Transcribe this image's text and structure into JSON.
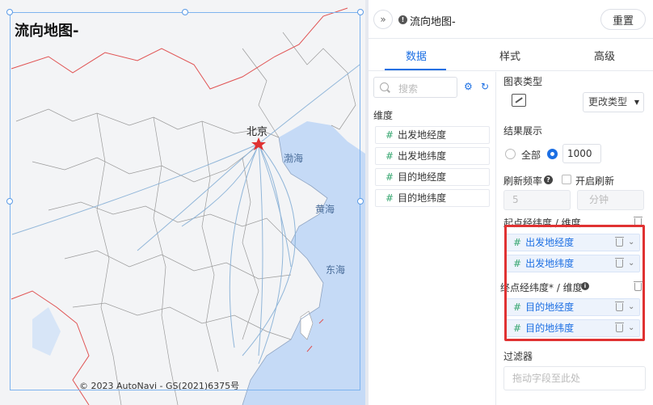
{
  "map": {
    "title": "流向地图-",
    "copyright": "© 2023 AutoNavi - GS(2021)6375号",
    "city_label": "北京",
    "sea_labels": [
      "渤海",
      "黄海",
      "东海"
    ]
  },
  "header": {
    "collapse_icon": "double-chevron-right-icon",
    "chart_name": "流向地图-",
    "reset_label": "重置"
  },
  "tabs": [
    "数据",
    "样式",
    "高级"
  ],
  "fields": {
    "search_placeholder": "搜索",
    "dimension_label": "维度",
    "items": [
      "出发地经度",
      "出发地纬度",
      "目的地经度",
      "目的地纬度"
    ]
  },
  "settings": {
    "chart_type_label": "图表类型",
    "change_type_label": "更改类型",
    "result_label": "结果展示",
    "option_all": "全部",
    "result_limit": "1000",
    "refresh_label": "刷新频率",
    "auto_refresh_label": "开启刷新",
    "refresh_value": "5",
    "refresh_unit": "分钟",
    "start_label": "起点经纬度 / 维度",
    "start_fields": [
      "出发地经度",
      "出发地纬度"
    ],
    "end_label": "终点经纬度* / 维度",
    "end_fields": [
      "目的地经度",
      "目的地纬度"
    ],
    "filter_label": "过滤器",
    "filter_placeholder": "拖动字段至此处"
  },
  "colors": {
    "accent": "#1c6fe3",
    "highlight": "#e03232",
    "field_hash": "#35a66f",
    "border_red_lines": "#e05252",
    "sea": "#bcd4f5"
  }
}
